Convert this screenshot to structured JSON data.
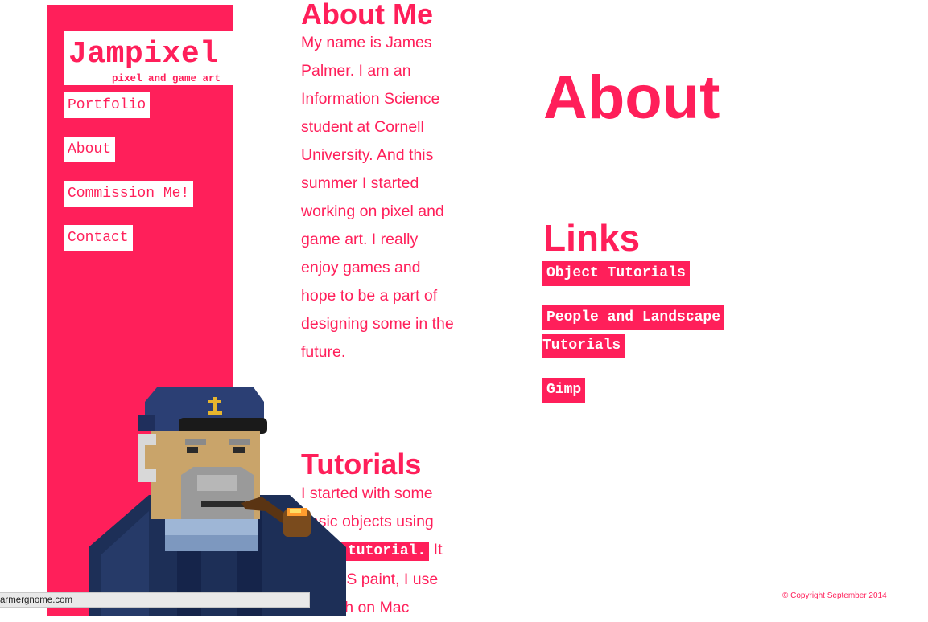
{
  "logo": {
    "title": "Jampixel",
    "subtitle": "pixel and game art"
  },
  "nav": [
    {
      "label": "Portfolio"
    },
    {
      "label": "About"
    },
    {
      "label": "Commission Me!"
    },
    {
      "label": "Contact"
    }
  ],
  "about_me": {
    "heading": "About Me",
    "lines": [
      "My name is James",
      "Palmer. I am an",
      "Information Science",
      "student at Cornell",
      "University. And this",
      "summer I started",
      "working on pixel and",
      "game art. I really",
      "enjoy games and",
      "hope to be a part of",
      "designing some in the",
      "future."
    ]
  },
  "tutorials": {
    "heading": "Tutorials",
    "line1": "I started with some",
    "line2": "basic objects using",
    "link": "this tutorial.",
    "after_link": " It",
    "line4": "was MS paint, I use",
    "line5": "a brush on Mac"
  },
  "page_title": "About",
  "links": {
    "heading": "Links",
    "items": [
      {
        "label": "Object Tutorials"
      },
      {
        "label_line1": "People and Landscape",
        "label_line2": "Tutorials"
      },
      {
        "label": "Gimp"
      }
    ]
  },
  "footer": "© Copyright September 2014",
  "status_url": "armergnome.com",
  "colors": {
    "accent": "#ff1f5a",
    "background": "#ffffff"
  },
  "illustration": "pixel-art sea captain smoking a pipe"
}
